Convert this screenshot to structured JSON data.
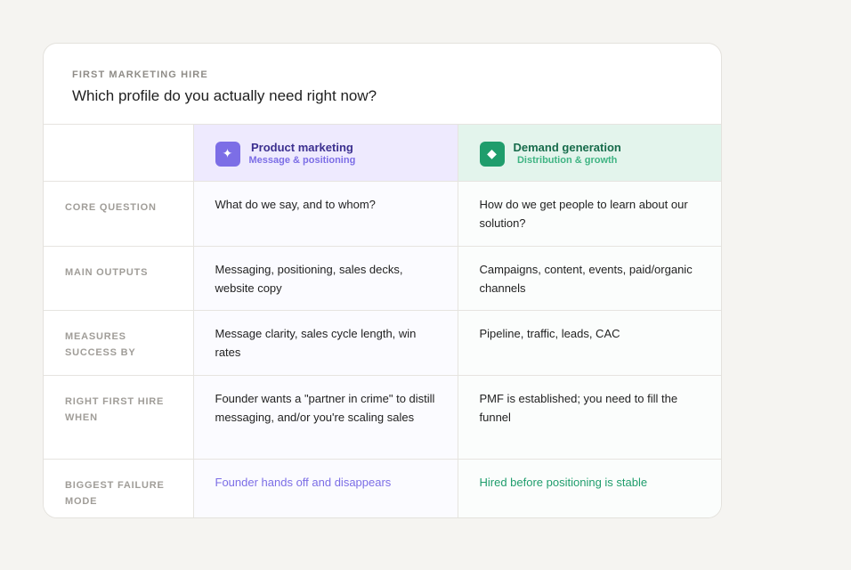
{
  "header": {
    "eyebrow": "FIRST MARKETING HIRE",
    "question": "Which profile do you actually need right now?"
  },
  "columns": {
    "product_marketing": {
      "icon": "sparkle-icon",
      "icon_glyph": "✦",
      "title": "Product marketing",
      "subtitle": "Message & positioning",
      "accent": "#7c6ee6"
    },
    "demand_generation": {
      "icon": "diamond-icon",
      "icon_glyph": "◆",
      "title": "Demand generation",
      "subtitle": "Distribution & growth",
      "accent": "#1f9d6c"
    }
  },
  "rows": [
    {
      "label": "CORE QUESTION",
      "product_marketing": "What do we say, and to whom?",
      "demand_generation": "How do we get people to learn about our solution?"
    },
    {
      "label": "MAIN OUTPUTS",
      "product_marketing": "Messaging, positioning, sales decks, website copy",
      "demand_generation": "Campaigns, content, events, paid/organic channels"
    },
    {
      "label": "MEASURES SUCCESS BY",
      "product_marketing": "Message clarity, sales cycle length, win rates",
      "demand_generation": "Pipeline, traffic, leads, CAC"
    },
    {
      "label": "RIGHT FIRST HIRE WHEN",
      "product_marketing": "Founder wants a \"partner in crime\" to distill messaging, and/or you're scaling sales",
      "demand_generation": "PMF is established; you need to fill the funnel"
    },
    {
      "label": "BIGGEST FAILURE MODE",
      "product_marketing": "Founder hands off and disappears",
      "demand_generation": "Hired before positioning is stable"
    }
  ]
}
